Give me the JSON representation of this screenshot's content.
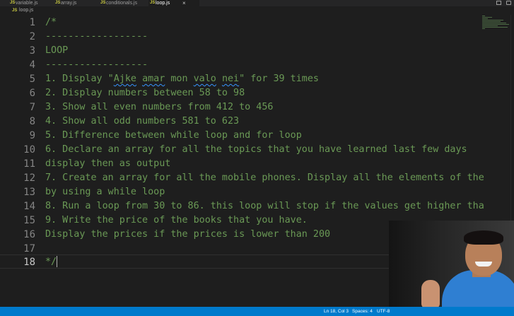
{
  "tabs": [
    {
      "label": "variable.js",
      "icon": "JS"
    },
    {
      "label": "array.js",
      "icon": "JS"
    },
    {
      "label": "conditionals.js",
      "icon": "JS"
    },
    {
      "label": "loop.js",
      "icon": "JS"
    }
  ],
  "close_glyph": "×",
  "breadcrumb": {
    "icon": "JS",
    "file": "loop.js"
  },
  "lines": [
    {
      "n": "1",
      "text": "/*"
    },
    {
      "n": "2",
      "text": "------------------"
    },
    {
      "n": "3",
      "text": "LOOP"
    },
    {
      "n": "4",
      "text": "------------------"
    },
    {
      "n": "5",
      "pre": "1. Display \"",
      "w1": "Ajke",
      "mid1": " ",
      "w2": "amar",
      "mid2": " mon ",
      "w3": "valo",
      "mid3": " ",
      "w4": "nei",
      "post": "\" for 39 times"
    },
    {
      "n": "6",
      "text": "2. Display numbers between 58 to 98"
    },
    {
      "n": "7",
      "text": "3. Show all even numbers from 412 to 456"
    },
    {
      "n": "8",
      "text": "4. Show all odd numbers 581 to 623"
    },
    {
      "n": "9",
      "text": "5. Difference between while loop and for loop"
    },
    {
      "n": "10",
      "text": "6. Declare an array for all the topics that you have learned last few days"
    },
    {
      "n": "11",
      "text": "display then as output"
    },
    {
      "n": "12",
      "text": "7. Create an array for all the mobile phones. Display all the elements of the"
    },
    {
      "n": "13",
      "text": "by using a while loop"
    },
    {
      "n": "14",
      "text": "8. Run a loop from 30 to 86. this loop will stop if the values get higher tha"
    },
    {
      "n": "15",
      "text": "9. Write the price of the books that you have."
    },
    {
      "n": "16",
      "text": "Display the prices if the prices is lower than 200"
    },
    {
      "n": "17",
      "text": ""
    },
    {
      "n": "18",
      "text": "*/"
    }
  ],
  "status": {
    "position": "Ln 18, Col 3",
    "spaces": "Spaces: 4",
    "encoding": "UTF-8"
  },
  "colors": {
    "accent": "#007acc",
    "comment": "#6a9955",
    "editor_bg": "#1e1e1e"
  }
}
